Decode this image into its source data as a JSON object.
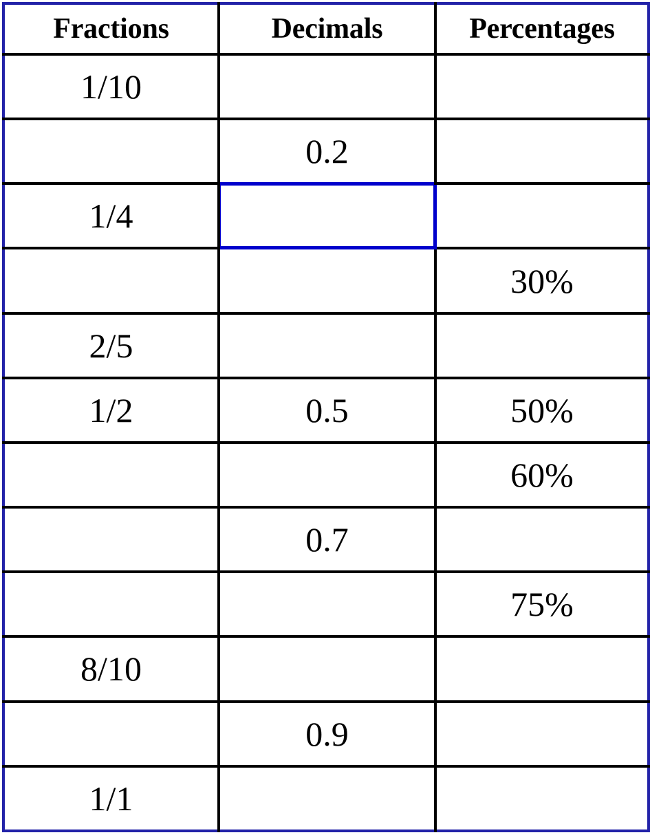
{
  "document": {
    "kind": "worksheet-table",
    "background_color": "#ffffff",
    "outer_border_color": "#2222a8",
    "grid_line_color": "#000000",
    "selection_border_color": "#0000cc"
  },
  "table": {
    "columns": [
      {
        "key": "fractions",
        "label": "Fractions"
      },
      {
        "key": "decimals",
        "label": "Decimals"
      },
      {
        "key": "percentages",
        "label": "Percentages"
      }
    ],
    "selected_cell": {
      "row": 3,
      "column": "decimals"
    },
    "rows": [
      {
        "fractions": "1/10",
        "decimals": "",
        "percentages": ""
      },
      {
        "fractions": "",
        "decimals": "0.2",
        "percentages": ""
      },
      {
        "fractions": "1/4",
        "decimals": "",
        "percentages": ""
      },
      {
        "fractions": "",
        "decimals": "",
        "percentages": "30%"
      },
      {
        "fractions": "2/5",
        "decimals": "",
        "percentages": ""
      },
      {
        "fractions": "1/2",
        "decimals": "0.5",
        "percentages": "50%"
      },
      {
        "fractions": "",
        "decimals": "",
        "percentages": "60%"
      },
      {
        "fractions": "",
        "decimals": "0.7",
        "percentages": ""
      },
      {
        "fractions": "",
        "decimals": "",
        "percentages": "75%"
      },
      {
        "fractions": "8/10",
        "decimals": "",
        "percentages": ""
      },
      {
        "fractions": "",
        "decimals": "0.9",
        "percentages": ""
      },
      {
        "fractions": "1/1",
        "decimals": "",
        "percentages": ""
      }
    ]
  }
}
